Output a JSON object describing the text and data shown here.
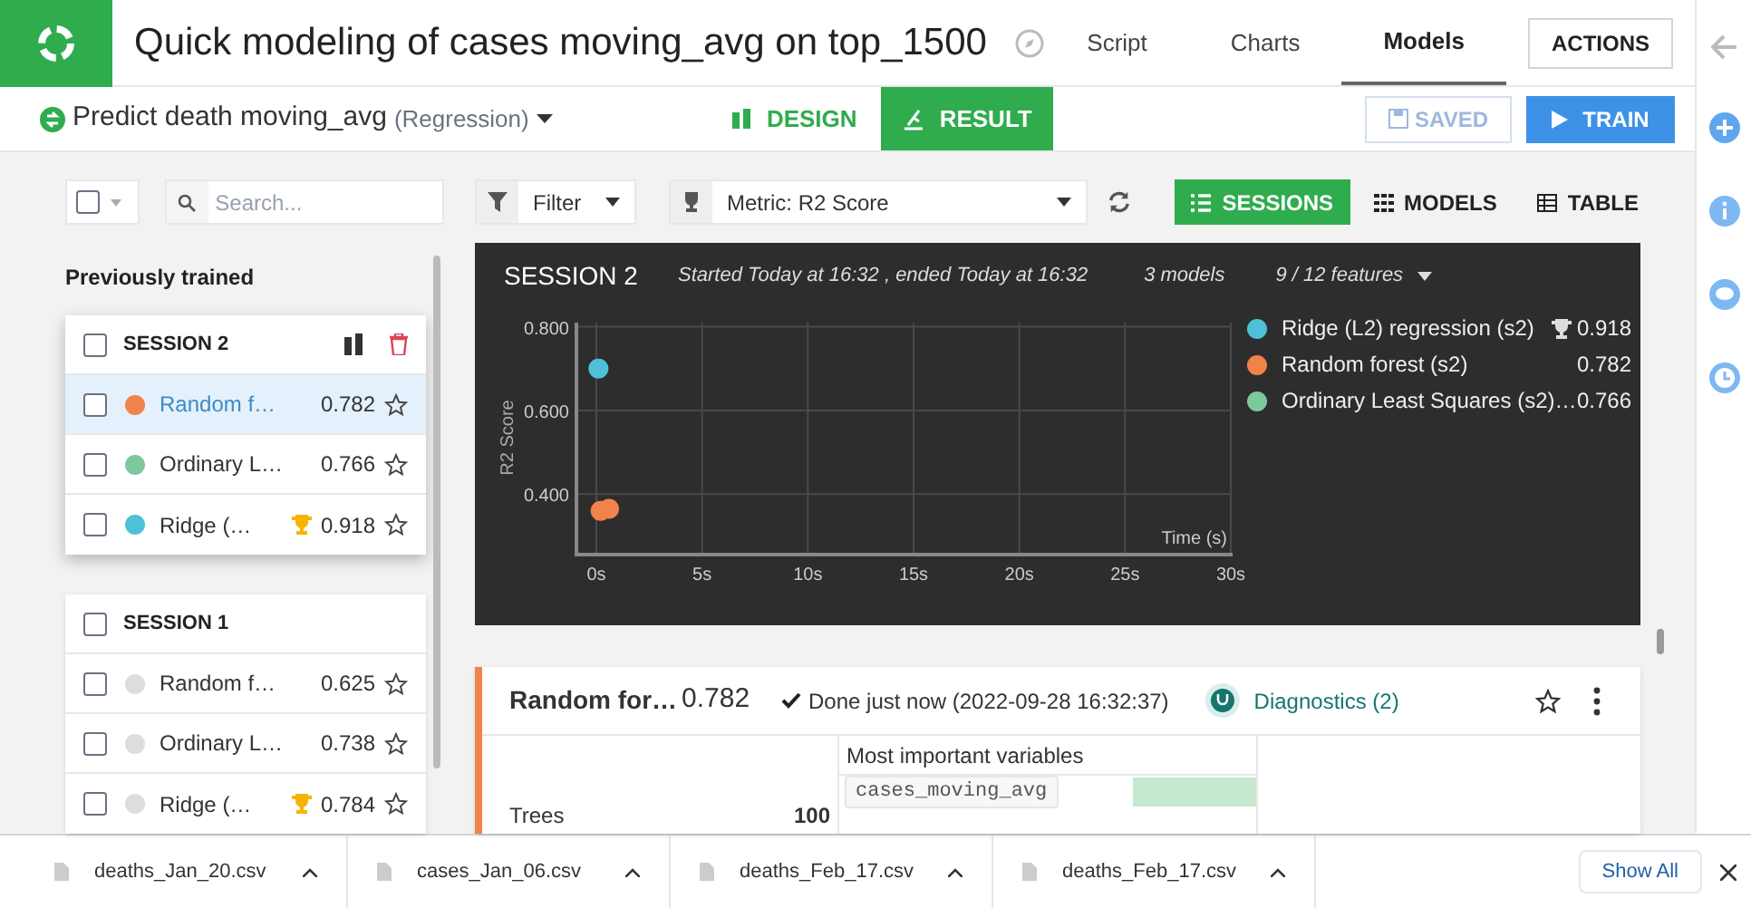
{
  "header": {
    "title": "Quick modeling of cases moving_avg on top_1500",
    "nav": [
      {
        "label": "Script",
        "selected": false
      },
      {
        "label": "Charts",
        "selected": false
      },
      {
        "label": "Models",
        "selected": true
      }
    ],
    "actions_button": "ACTIONS"
  },
  "subheader": {
    "task": "Predict death moving_avg",
    "task_type": "(Regression)",
    "tabs": [
      {
        "label": "DESIGN",
        "selected": false
      },
      {
        "label": "RESULT",
        "selected": true
      }
    ],
    "saved_button": {
      "label": "SAVED",
      "disabled": true
    },
    "train_button": "TRAIN"
  },
  "toolbar": {
    "select_all": {
      "checked": false
    },
    "search": {
      "placeholder": "Search..."
    },
    "filter": "Filter",
    "metric": "Metric: R2 Score",
    "views": [
      {
        "label": "SESSIONS",
        "selected": true
      },
      {
        "label": "MODELS",
        "selected": false
      },
      {
        "label": "TABLE",
        "selected": false
      }
    ]
  },
  "sidebar": {
    "heading": "Previously trained",
    "sessions": [
      {
        "title": "SESSION 2",
        "checked": false,
        "actions": true,
        "models": [
          {
            "name": "Random f…",
            "score": "0.782",
            "color": "#f0834a",
            "selected": true,
            "checked": false,
            "best": false,
            "starred": false
          },
          {
            "name": "Ordinary L…",
            "score": "0.766",
            "color": "#7ec89e",
            "selected": false,
            "checked": false,
            "best": false,
            "starred": false
          },
          {
            "name": "Ridge (…",
            "score": "0.918",
            "color": "#4ec1d9",
            "selected": false,
            "checked": false,
            "best": true,
            "starred": false
          }
        ]
      },
      {
        "title": "SESSION 1",
        "checked": false,
        "actions": false,
        "models": [
          {
            "name": "Random f…",
            "score": "0.625",
            "color": "#dddddd",
            "selected": false,
            "checked": false,
            "best": false,
            "starred": false
          },
          {
            "name": "Ordinary L…",
            "score": "0.738",
            "color": "#dddddd",
            "selected": false,
            "checked": false,
            "best": false,
            "starred": false
          },
          {
            "name": "Ridge (…",
            "score": "0.784",
            "color": "#dddddd",
            "selected": false,
            "checked": false,
            "best": true,
            "starred": false
          }
        ]
      }
    ]
  },
  "session_panel": {
    "title": "SESSION 2",
    "timing": "Started Today at 16:32 , ended Today at 16:32",
    "models_count": "3 models",
    "features": "9 / 12 features",
    "legend": [
      {
        "score": "0.918",
        "best": true
      },
      {
        "score": "0.782",
        "best": false
      },
      {
        "score": "0.766",
        "best": false
      }
    ],
    "chart_data": {
      "type": "scatter",
      "grid": true,
      "xlabel": "Time (s)",
      "ylabel": "R2 Score",
      "xlim": [
        0,
        30
      ],
      "ylim": [
        0.26,
        0.81
      ],
      "xticks": [
        {
          "value": 0,
          "label": "0s"
        },
        {
          "value": 5,
          "label": "5s"
        },
        {
          "value": 10,
          "label": "10s"
        },
        {
          "value": 15,
          "label": "15s"
        },
        {
          "value": 20,
          "label": "20s"
        },
        {
          "value": 25,
          "label": "25s"
        },
        {
          "value": 30,
          "label": "30s"
        }
      ],
      "yticks": [
        {
          "value": 0.4,
          "label": "0.400"
        },
        {
          "value": 0.6,
          "label": "0.600"
        },
        {
          "value": 0.8,
          "label": "0.800"
        }
      ],
      "series": [
        {
          "name": "Ridge (L2) regression (s2)",
          "color": "#4ec1d9",
          "x": [
            0.1
          ],
          "values": [
            0.7
          ]
        },
        {
          "name": "Random forest (s2)",
          "color": "#f0834a",
          "x": [
            0.2,
            0.6
          ],
          "values": [
            0.36,
            0.365
          ]
        },
        {
          "name": "Ordinary Least Squares (s2)…",
          "color": "#7ec89e",
          "x": [
            null
          ],
          "values": [
            null
          ]
        }
      ]
    }
  },
  "model_card": {
    "name": "Random for…",
    "score": "0.782",
    "status": "Done just now (2022-09-28 16:32:37)",
    "diagnostics": "Diagnostics (2)",
    "starred": false,
    "param_label": "Trees",
    "param_value": "100",
    "variables_title": "Most important variables",
    "variables": [
      {
        "name": "cases_moving_avg",
        "level": 1
      }
    ]
  },
  "downloads": {
    "files": [
      "deaths_Jan_20.csv",
      "cases_Jan_06.csv",
      "deaths_Feb_17.csv",
      "deaths_Feb_17.csv"
    ],
    "show_all": "Show All"
  }
}
